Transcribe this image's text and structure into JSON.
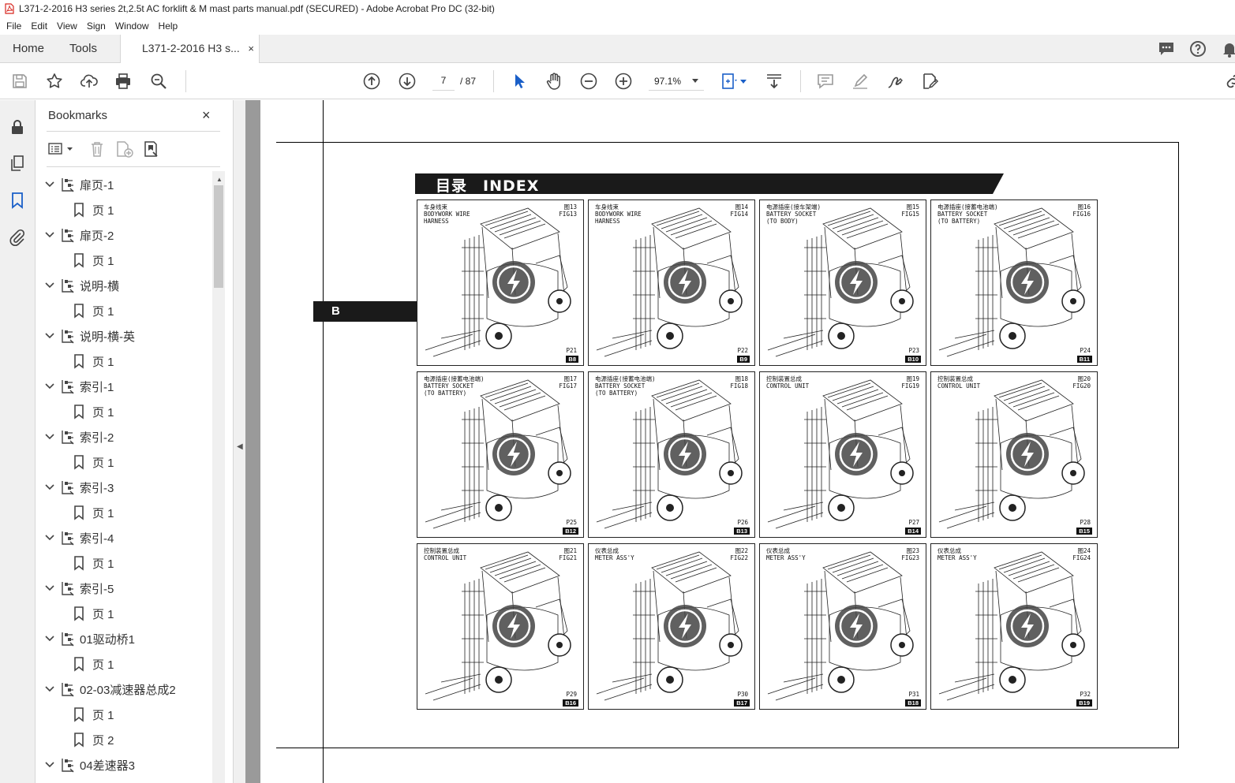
{
  "window": {
    "title": "L371-2-2016 H3 series 2t,2.5t AC forklift & M mast parts manual.pdf (SECURED) - Adobe Acrobat Pro DC (32-bit)"
  },
  "menu": [
    "File",
    "Edit",
    "View",
    "Sign",
    "Window",
    "Help"
  ],
  "tabs": {
    "home": "Home",
    "tools": "Tools",
    "doc": "L371-2-2016 H3 s...",
    "close": "×"
  },
  "toolbar": {
    "page_current": "7",
    "page_total": "/ 87",
    "zoom": "97.1%"
  },
  "icons": {
    "toolbar": [
      "save-icon",
      "bookmark-star-icon",
      "upload-icon",
      "print-icon",
      "zoom-search-icon",
      "prev-page-icon",
      "next-page-icon",
      "select-cursor-icon",
      "hand-icon",
      "zoom-out-icon",
      "zoom-in-icon",
      "fit-page-icon",
      "scroll-mode-icon",
      "comment-icon",
      "highlight-icon",
      "sign-icon",
      "fill-sign-icon"
    ],
    "rail": [
      "lock-icon",
      "pages-icon",
      "bookmarks-icon",
      "attachments-icon"
    ]
  },
  "bookmarks": {
    "title": "Bookmarks",
    "close": "×",
    "items": [
      {
        "label": "扉页-1",
        "level": 0
      },
      {
        "label": "页 1",
        "level": 1
      },
      {
        "label": "扉页-2",
        "level": 0
      },
      {
        "label": "页 1",
        "level": 1
      },
      {
        "label": "说明-横",
        "level": 0
      },
      {
        "label": "页 1",
        "level": 1
      },
      {
        "label": "说明-横-英",
        "level": 0
      },
      {
        "label": "页 1",
        "level": 1
      },
      {
        "label": "索引-1",
        "level": 0
      },
      {
        "label": "页 1",
        "level": 1
      },
      {
        "label": "索引-2",
        "level": 0
      },
      {
        "label": "页 1",
        "level": 1
      },
      {
        "label": "索引-3",
        "level": 0
      },
      {
        "label": "页 1",
        "level": 1
      },
      {
        "label": "索引-4",
        "level": 0
      },
      {
        "label": "页 1",
        "level": 1
      },
      {
        "label": "索引-5",
        "level": 0
      },
      {
        "label": "页 1",
        "level": 1
      },
      {
        "label": "01驱动桥1",
        "level": 0
      },
      {
        "label": "页 1",
        "level": 1
      },
      {
        "label": "02-03减速器总成2",
        "level": 0
      },
      {
        "label": "页 1",
        "level": 1
      },
      {
        "label": "页 2",
        "level": 1
      },
      {
        "label": "04差速器3",
        "level": 0
      }
    ]
  },
  "document": {
    "index_title": "目录　INDEX",
    "section_tab": "B",
    "thumbnails": [
      {
        "title": "车身线束\nBODYWORK WIRE\nHARNESS",
        "fig": "图13\nFIG13",
        "page": "P21",
        "code": "B8"
      },
      {
        "title": "车身线束\nBODYWORK WIRE\nHARNESS",
        "fig": "图14\nFIG14",
        "page": "P22",
        "code": "B9"
      },
      {
        "title": "电源插座(接车架端)\nBATTERY SOCKET\n(TO BODY)",
        "fig": "图15\nFIG15",
        "page": "P23",
        "code": "B10"
      },
      {
        "title": "电源插座(接蓄电池端)\nBATTERY SOCKET\n(TO BATTERY)",
        "fig": "图16\nFIG16",
        "page": "P24",
        "code": "B11"
      },
      {
        "title": "电源插座(接蓄电池端)\nBATTERY SOCKET\n(TO BATTERY)",
        "fig": "图17\nFIG17",
        "page": "P25",
        "code": "B12"
      },
      {
        "title": "电源插座(接蓄电池端)\nBATTERY SOCKET\n(TO BATTERY)",
        "fig": "图18\nFIG18",
        "page": "P26",
        "code": "B13"
      },
      {
        "title": "控制装置总成\nCONTROL UNIT",
        "fig": "图19\nFIG19",
        "page": "P27",
        "code": "B14"
      },
      {
        "title": "控制装置总成\nCONTROL UNIT",
        "fig": "图20\nFIG20",
        "page": "P28",
        "code": "B15"
      },
      {
        "title": "控制装置总成\nCONTROL UNIT",
        "fig": "图21\nFIG21",
        "page": "P29",
        "code": "B16"
      },
      {
        "title": "仪表总成\nMETER ASS'Y",
        "fig": "图22\nFIG22",
        "page": "P30",
        "code": "B17"
      },
      {
        "title": "仪表总成\nMETER ASS'Y",
        "fig": "图23\nFIG23",
        "page": "P31",
        "code": "B18"
      },
      {
        "title": "仪表总成\nMETER ASS'Y",
        "fig": "图24\nFIG24",
        "page": "P32",
        "code": "B19"
      }
    ]
  }
}
